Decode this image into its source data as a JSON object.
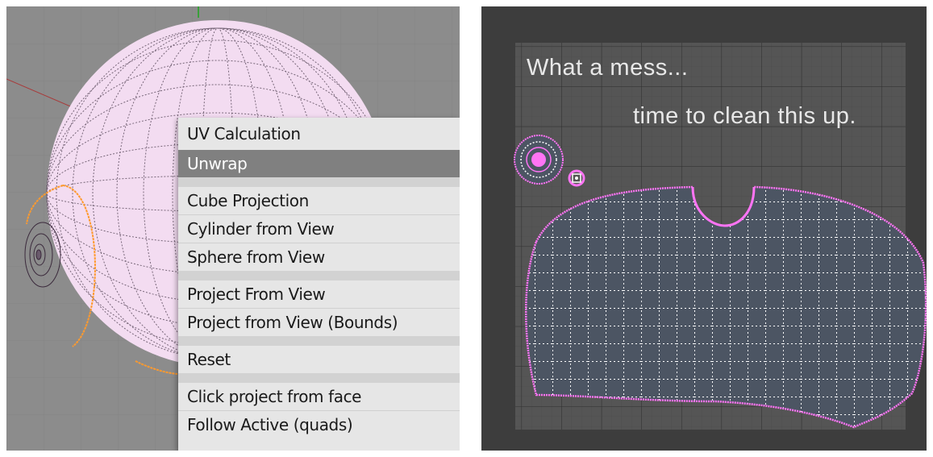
{
  "menu": {
    "title": "UV Calculation",
    "items": [
      {
        "label": "Unwrap",
        "active": true
      },
      {
        "label": "Cube Projection"
      },
      {
        "label": "Cylinder from View"
      },
      {
        "label": "Sphere from View"
      },
      {
        "label": "Project From View"
      },
      {
        "label": "Project from View (Bounds)"
      },
      {
        "label": "Reset"
      },
      {
        "label": "Click project from face"
      },
      {
        "label": "Follow Active (quads)"
      }
    ]
  },
  "uv_editor": {
    "annotation_line1": "What a mess...",
    "annotation_line2": "time to clean this up."
  },
  "colors": {
    "viewport_bg": "#8c8c8c",
    "mesh_face": "#f3dcf1",
    "mesh_wire": "#3b2a3c",
    "seam": "#ff9a2e",
    "menu_bg": "#e6e6e6",
    "menu_highlight": "#808080",
    "uv_bg": "#3d3d3d",
    "uv_face": "#4c5563",
    "uv_vertex": "#ff74f5"
  }
}
